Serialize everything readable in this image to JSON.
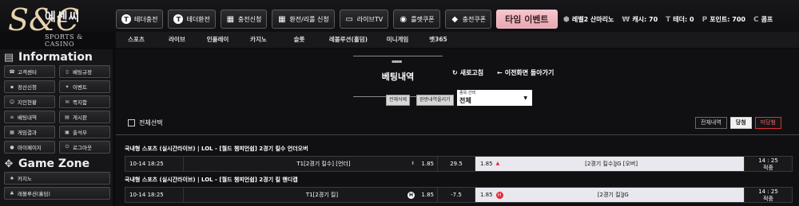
{
  "logo": {
    "mono": "S&C",
    "kname": "에센씨",
    "sub": "SPORTS & CASINO"
  },
  "topnav": [
    {
      "label": "테더충전",
      "icon": "tether-icon"
    },
    {
      "label": "테더환전",
      "icon": "tether-icon"
    },
    {
      "label": "충전신청",
      "icon": "grid-icon"
    },
    {
      "label": "환전/리롤 신청",
      "icon": "grid-icon"
    },
    {
      "label": "라이브TV",
      "icon": "tv-icon"
    },
    {
      "label": "룰렛쿠폰",
      "icon": "roulette-icon"
    },
    {
      "label": "충전쿠폰",
      "icon": "coupon-icon"
    }
  ],
  "time_event": "타임 이벤트",
  "user": {
    "level": "레벨2 산마리노",
    "cash": "캐시: 70",
    "tether": "테더: 0",
    "points": "포인트: 700",
    "comp": "콤프"
  },
  "subnav": [
    "스포츠",
    "라이브",
    "인플레이",
    "카지노",
    "슬롯",
    "레볼루션(홀덤)",
    "미니게임",
    "벳365"
  ],
  "sidebar": {
    "info_title": "Information",
    "info_items": [
      {
        "label": "고객센터",
        "icon": "headset-icon"
      },
      {
        "label": "베팅규정",
        "icon": "book-icon"
      },
      {
        "label": "정산신청",
        "icon": "calc-icon"
      },
      {
        "label": "이벤트",
        "icon": "gift-icon"
      },
      {
        "label": "지인현황",
        "icon": "people-icon"
      },
      {
        "label": "쪽지함",
        "icon": "mail-icon"
      },
      {
        "label": "베팅내역",
        "icon": "list-icon"
      },
      {
        "label": "게시판",
        "icon": "board-icon"
      },
      {
        "label": "게임결과",
        "icon": "result-icon"
      },
      {
        "label": "출석부",
        "icon": "calendar-icon"
      },
      {
        "label": "마이페이지",
        "icon": "user-icon"
      },
      {
        "label": "로그아웃",
        "icon": "power-icon"
      }
    ],
    "gamezone_title": "Game Zone",
    "gamezone_items": [
      {
        "label": "카지노",
        "icon": "casino-icon"
      },
      {
        "label": "레볼루션(홀덤)",
        "icon": "cards-icon"
      }
    ]
  },
  "main": {
    "title": "베팅내역",
    "refresh": "새로고침",
    "goback": "이전화면 돌아가기",
    "delete_all": "전체삭제",
    "upload_history": "완방내역올리기",
    "type_select_label": "종목 선택",
    "type_select_value": "전체",
    "select_all": "전체선택",
    "filters": [
      "전체내역",
      "당첨",
      "미당첨"
    ]
  },
  "bets": [
    {
      "header": "국내형 스포츠 (실시간라이브) | LOL - [월드 챔피언쉽] 2경기 킬수 언더오버",
      "date": "10-14 18:25",
      "home": "T1[2경기 킬수] [언더]",
      "home_odds": "1.85",
      "mid": "29.5",
      "away_odds": "1.85",
      "away": "[2경기 킬수]JG [오버]",
      "time": "14 : 25",
      "status": "적중"
    },
    {
      "header": "국내형 스포츠 (실시간라이브) | LOL - [월드 챔피언쉽] 2경기 킬 핸디캡",
      "date": "10-14 18:25",
      "home": "T1[2경기 킬]",
      "home_odds": "1.85",
      "mid": "-7.5",
      "away_odds": "1.85",
      "away": "[2경기 킬]JG",
      "time": "14 : 25",
      "status": "적중"
    }
  ]
}
